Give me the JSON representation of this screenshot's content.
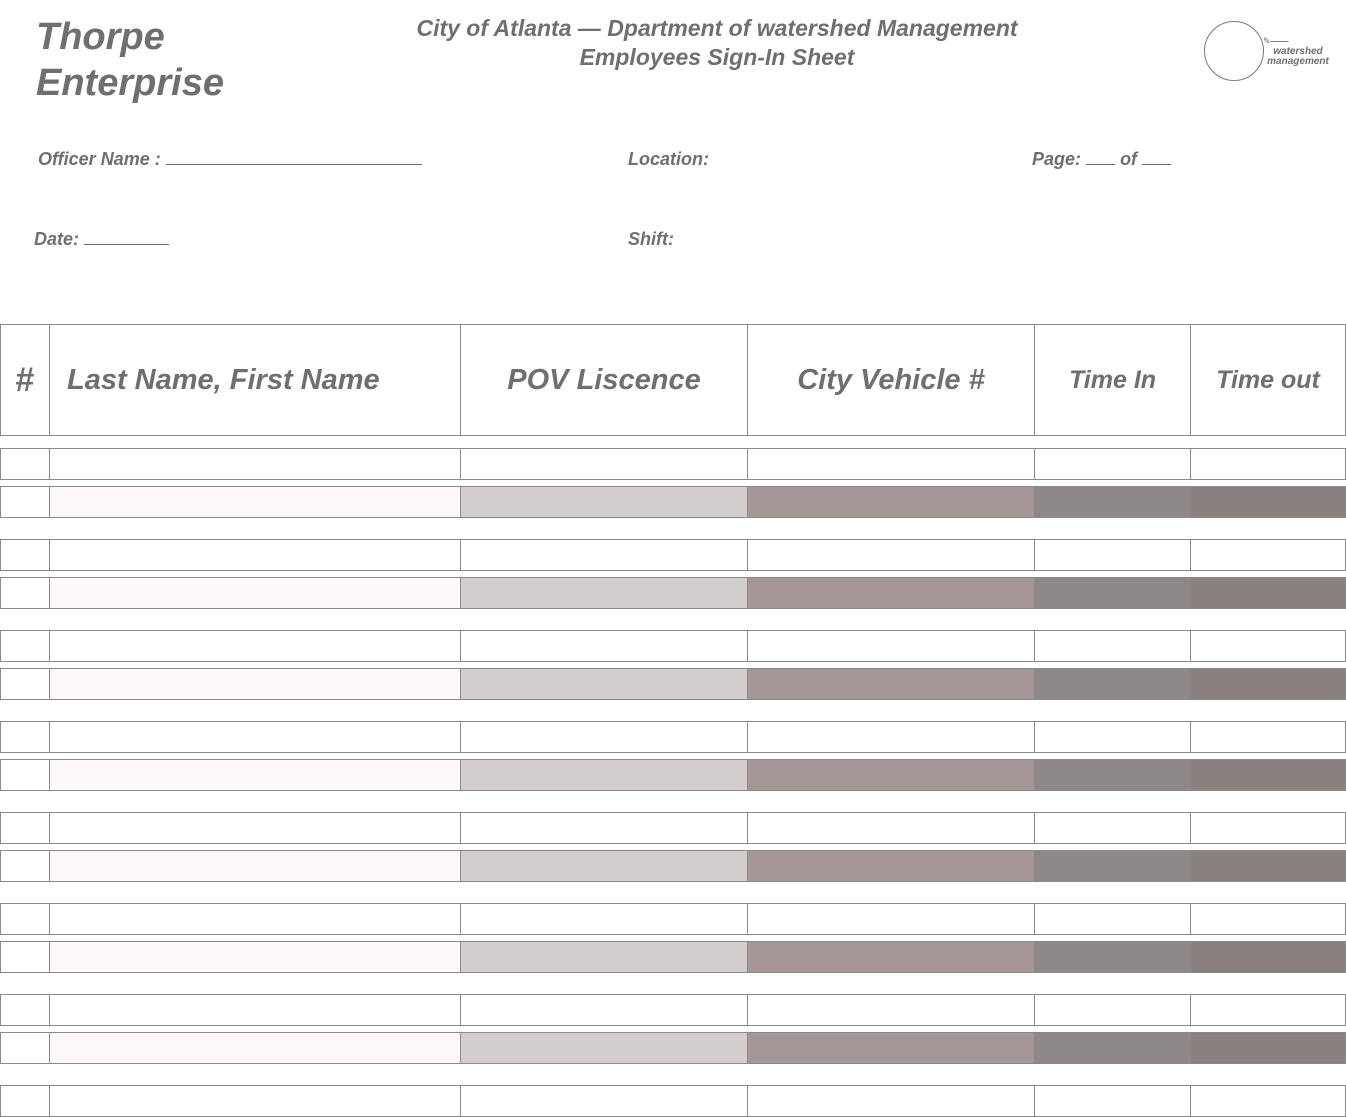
{
  "company": {
    "line1": "Thorpe",
    "line2": "Enterprise"
  },
  "title": {
    "line1": "City of Atlanta — Dpartment of watershed Management",
    "line2": "Employees Sign-In Sheet"
  },
  "logo": {
    "line1": "watershed",
    "line2": "management"
  },
  "fields": {
    "officer_label": "Officer Name :",
    "location_label": "Location:",
    "page_label": "Page:",
    "page_of": "of",
    "date_label": "Date:",
    "shift_label": "Shift:"
  },
  "table": {
    "headers": [
      "#",
      "Last Name, First Name",
      "POV Liscence",
      "City Vehicle #",
      "Time In",
      "Time out"
    ],
    "row_pairs": 7,
    "colors": {
      "name_tint": "#fff8f8",
      "pov_tint": "#d3cdcd",
      "vehicle_tint": "#a69797",
      "timein_tint": "#8e8888",
      "timeout_tint": "#8a807e"
    }
  }
}
